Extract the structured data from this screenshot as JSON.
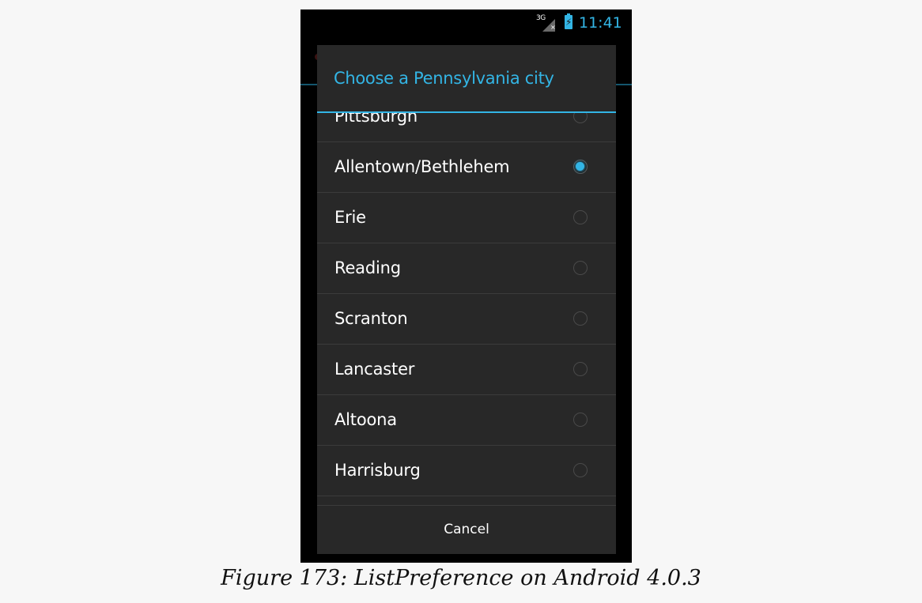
{
  "status_bar": {
    "network": "3G",
    "time": "11:41"
  },
  "dialog": {
    "title": "Choose a Pennsylvania city",
    "items": [
      {
        "label": "Pittsburgh",
        "checked": false
      },
      {
        "label": "Allentown/Bethlehem",
        "checked": true
      },
      {
        "label": "Erie",
        "checked": false
      },
      {
        "label": "Reading",
        "checked": false
      },
      {
        "label": "Scranton",
        "checked": false
      },
      {
        "label": "Lancaster",
        "checked": false
      },
      {
        "label": "Altoona",
        "checked": false
      },
      {
        "label": "Harrisburg",
        "checked": false
      }
    ],
    "cancel_label": "Cancel"
  },
  "caption": "Figure 173: ListPreference on Android 4.0.3",
  "colors": {
    "accent": "#33b5e5",
    "dialog_bg": "#282828",
    "page_bg": "#f7f7f7"
  }
}
